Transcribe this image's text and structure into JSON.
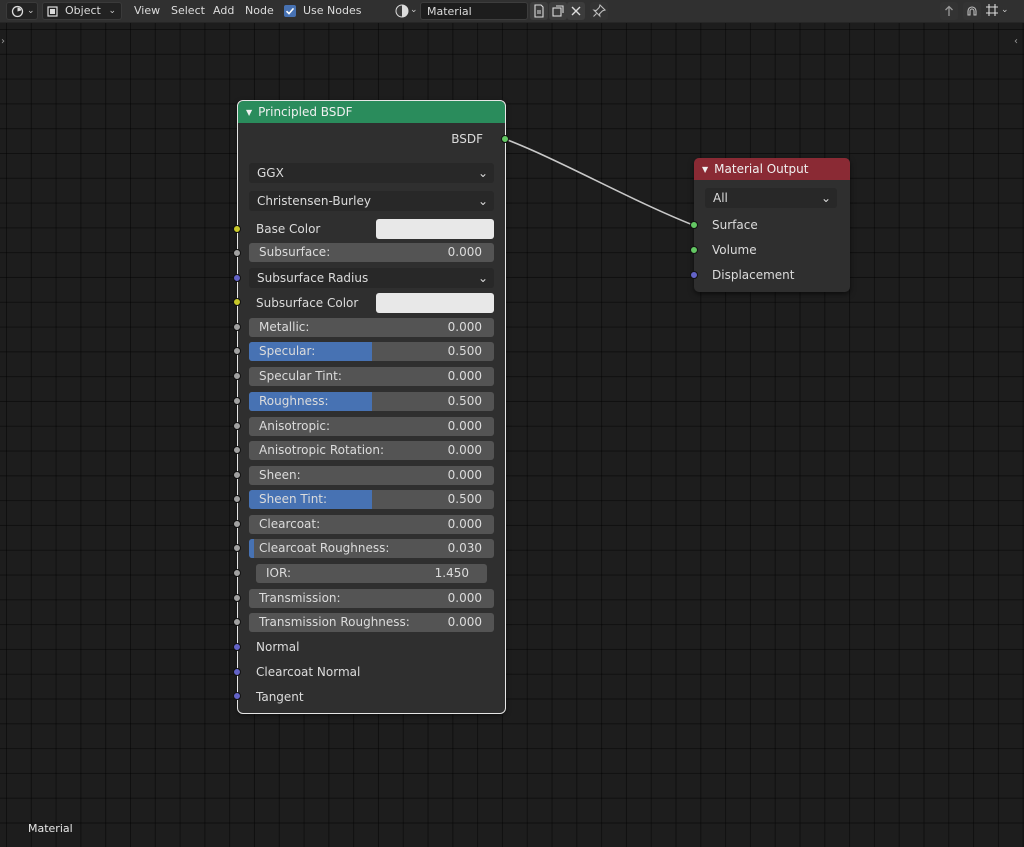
{
  "header": {
    "mode_label": "Object",
    "menu": [
      "View",
      "Select",
      "Add",
      "Node"
    ],
    "use_nodes_label": "Use Nodes",
    "use_nodes_checked": true,
    "material_name": "Material"
  },
  "principled": {
    "title": "Principled BSDF",
    "output_label": "BSDF",
    "distribution": "GGX",
    "subsurface_method": "Christensen-Burley",
    "base_color_label": "Base Color",
    "subsurface_radius_label": "Subsurface Radius",
    "subsurface_color_label": "Subsurface Color",
    "sliders": [
      {
        "label": "Subsurface:",
        "value": "0.000",
        "fraction": 0
      },
      {
        "label": "Metallic:",
        "value": "0.000",
        "fraction": 0
      },
      {
        "label": "Specular:",
        "value": "0.500",
        "fraction": 0.5
      },
      {
        "label": "Specular Tint:",
        "value": "0.000",
        "fraction": 0
      },
      {
        "label": "Roughness:",
        "value": "0.500",
        "fraction": 0.5
      },
      {
        "label": "Anisotropic:",
        "value": "0.000",
        "fraction": 0
      },
      {
        "label": "Anisotropic Rotation:",
        "value": "0.000",
        "fraction": 0
      },
      {
        "label": "Sheen:",
        "value": "0.000",
        "fraction": 0
      },
      {
        "label": "Sheen Tint:",
        "value": "0.500",
        "fraction": 0.5
      },
      {
        "label": "Clearcoat:",
        "value": "0.000",
        "fraction": 0
      },
      {
        "label": "Clearcoat Roughness:",
        "value": "0.030",
        "fraction": 0.03
      },
      {
        "label": "IOR:",
        "value": "1.450",
        "fraction": 0
      },
      {
        "label": "Transmission:",
        "value": "0.000",
        "fraction": 0
      },
      {
        "label": "Transmission Roughness:",
        "value": "0.000",
        "fraction": 0
      }
    ],
    "normal_label": "Normal",
    "clearcoat_normal_label": "Clearcoat Normal",
    "tangent_label": "Tangent"
  },
  "output_node": {
    "title": "Material Output",
    "target": "All",
    "inputs": [
      "Surface",
      "Volume",
      "Displacement"
    ]
  },
  "footer_label": "Material",
  "colors": {
    "principled_header": "#2a8c5c",
    "output_header": "#8a2a34",
    "slider_fill": "#4772b3"
  }
}
